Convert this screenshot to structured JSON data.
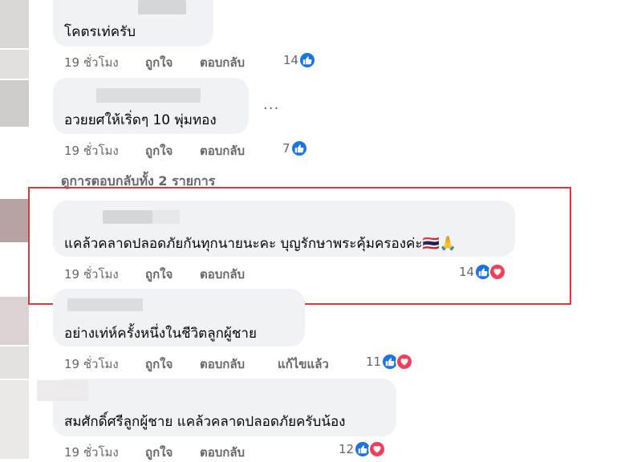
{
  "comments": [
    {
      "text": "โคตรเท่ครับ",
      "time": "19 ชั่วโมง",
      "like": "ถูกใจ",
      "reply": "ตอบกลับ",
      "edited": "",
      "reactions": "14",
      "reaction_types": [
        "like-icon"
      ]
    },
    {
      "text": "อวยยศให้เริ่ดๆ 10 พุ่มทอง",
      "time": "19 ชั่วโมง",
      "like": "ถูกใจ",
      "reply": "ตอบกลับ",
      "edited": "",
      "reactions": "7",
      "reaction_types": [
        "like-icon"
      ]
    },
    {
      "text": "แคล้วคลาดปลอดภัยกันทุกนายนะคะ บุญรักษาพระคุ้มครองค่ะ🇹🇭🙏",
      "time": "19 ชั่วโมง",
      "like": "ถูกใจ",
      "reply": "ตอบกลับ",
      "edited": "",
      "reactions": "14",
      "reaction_types": [
        "like-icon",
        "love-icon"
      ]
    },
    {
      "text": "อย่างเท่ห์ครั้งหนึ่งในชีวิตลูกผู้ชาย",
      "time": "19 ชั่วโมง",
      "like": "ถูกใจ",
      "reply": "ตอบกลับ",
      "edited": "แก้ไขแล้ว",
      "reactions": "11",
      "reaction_types": [
        "like-icon",
        "love-icon"
      ]
    },
    {
      "text": "สมศักดิ์ศรีลูกผู้ชาย แคล้วคลาดปลอดภัยครับน้อง",
      "time": "19 ชั่วโมง",
      "like": "ถูกใจ",
      "reply": "ตอบกลับ",
      "edited": "",
      "reactions": "12",
      "reaction_types": [
        "like-icon",
        "love-icon"
      ]
    }
  ],
  "view_replies": "ดูการตอบกลับทั้ง 2 รายการ",
  "more_options": "...",
  "colors": {
    "like": "#1b74e4",
    "love": "#f33e58",
    "highlight": "#d93a3a",
    "bubble": "#f0f2f5"
  }
}
